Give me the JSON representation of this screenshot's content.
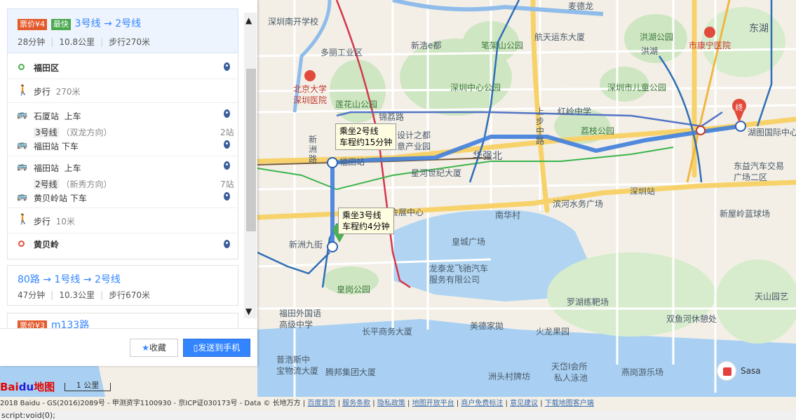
{
  "routes": [
    {
      "price": "票价¥4",
      "fast": "最快",
      "title": "3号线 → 2号线",
      "duration": "28分钟",
      "distance": "10.8公里",
      "walk": "步行270米",
      "steps": {
        "origin": "福田区",
        "walk1": "步行",
        "walk1_dist": "270米",
        "board1_station": "石厦站",
        "board1_action": "上车",
        "line1": "3号线",
        "line1_dir": "（双龙方向）",
        "line1_stops": "2站",
        "alight1": "福田站 下车",
        "board2_station": "福田站",
        "board2_action": "上车",
        "line2": "2号线",
        "line2_dir": "（新秀方向）",
        "line2_stops": "7站",
        "alight2": "黄贝岭站 下车",
        "walk2": "步行",
        "walk2_dist": "10米",
        "destination": "黄贝岭"
      }
    },
    {
      "title": "80路 → 1号线 → 2号线",
      "duration": "47分钟",
      "distance": "10.3公里",
      "walk": "步行670米"
    },
    {
      "price": "票价¥3",
      "title": "m133路"
    }
  ],
  "actions": {
    "collect": "收藏",
    "send": "发送到手机"
  },
  "map": {
    "scale_label": "1 公里",
    "logo_bai": "Bai",
    "logo_du": "du",
    "logo_map": "地图",
    "tip1_line1": "乘坐2号线",
    "tip1_line2": "车程约15分钟",
    "tip2_line1": "乘坐3号线",
    "tip2_line2": "车程约4分钟",
    "end_marker": "终",
    "sasa": "Sasa",
    "labels": {
      "shenzhen_nanshan_school": "深圳南开学校",
      "duoli": "多丽工业区",
      "xinzao": "新浩e都",
      "bijiashan": "笔架山公园",
      "hangtian": "航天运东大厦",
      "honghu_park": "洪湖公园",
      "honghu": "洪湖",
      "kangning": "市康宁医院",
      "donghu": "东湖",
      "meilong": "麦德龙",
      "pku_hospital_1": "北京大学",
      "pku_hospital_2": "深圳医院",
      "lianhuashan": "莲花山公园",
      "center_park": "深圳中心公园",
      "children_park": "深圳市儿童公园",
      "honglingzhong": "红岭中学",
      "lizhi_park": "荔枝公园",
      "huangtian": "湖图国际中心",
      "design": "设计之都",
      "industry_park": "意产业园",
      "jinhua": "锦荔路",
      "xinzhou": "新",
      "zhou": "洲",
      "lu": "路",
      "futian_station": "福田站",
      "xinghe": "星河世纪大厦",
      "huaqiang": "华强北",
      "shangbu_1": "上",
      "shangbu_2": "步",
      "shangbu_3": "中",
      "shangbu_4": "路",
      "dongyi": "东益汽车交易",
      "dongyi2": "广场二区",
      "shenzhen_station": "深圳站",
      "binhe": "滨河水务广场",
      "xinwuling": "新屋岭蓝球场",
      "convention": "会展中心",
      "nanhuacun": "南华村",
      "xinzhoujiu": "新洲九街",
      "huangcheng": "皇城广场",
      "longtai_1": "龙泰龙飞驰汽车",
      "longtai_2": "服务有限公司",
      "huanggang": "皇岗公园",
      "luohu_range": "罗湖练靶场",
      "tianshan": "天山园艺",
      "futian_waiyu_1": "福田外国语",
      "futian_waiyu_2": "高级中学",
      "meide": "美德家拋",
      "huolong": "火龙果园",
      "shuanghe": "双鱼河休憩处",
      "changping": "长平商务大厦",
      "puxin_1": "普浩斯中",
      "puxin_2": "宝物流大厦",
      "tengbang": "腾邦集团大厦",
      "tianju_1": "天岱I会所",
      "tianju_2": "私人泳池",
      "zhoutou": "洲头村牌坊",
      "yangang": "燕岗游乐场"
    }
  },
  "footer": {
    "copyright": "2018 Baidu - GS(2016)2089号 - 甲测资字1100930 - 京ICP证030173号 - Data © 长地万方 |",
    "links": [
      "百度首页",
      "服务条款",
      "隐私政策",
      "地图开放平台",
      "商户免费标注",
      "意见建议",
      "下载地图客户端"
    ]
  },
  "status": "script:void(0);"
}
